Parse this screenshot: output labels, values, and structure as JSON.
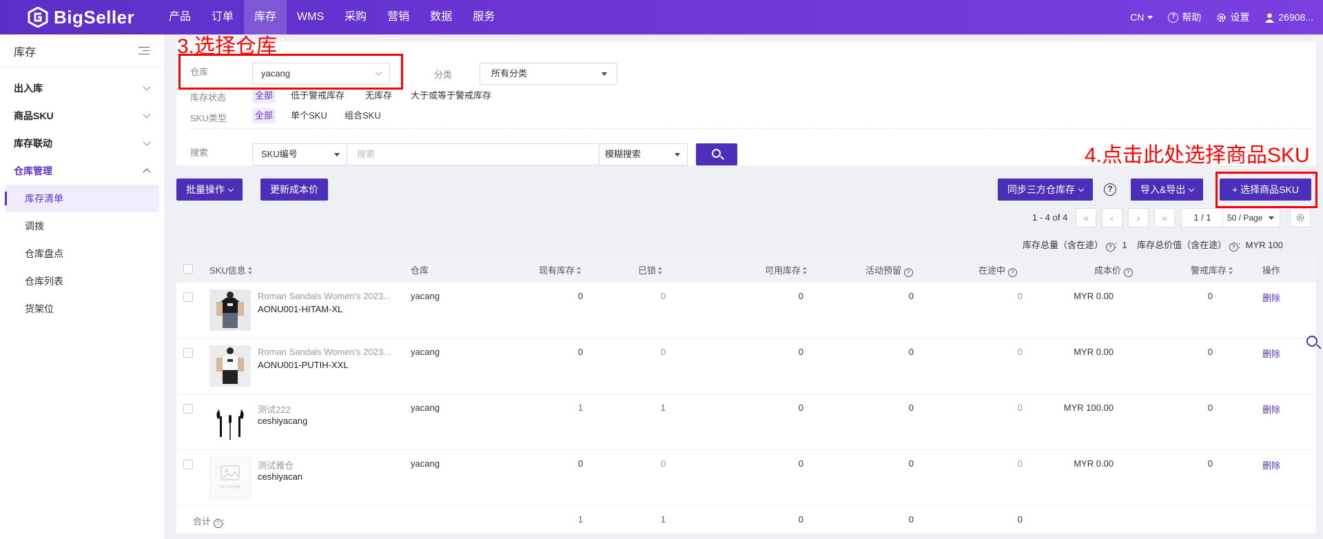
{
  "brand": {
    "name": "BigSeller"
  },
  "nav": {
    "items": [
      "产品",
      "订单",
      "库存",
      "WMS",
      "采购",
      "营销",
      "数据",
      "服务"
    ],
    "active": "库存"
  },
  "topbar": {
    "lang": "CN",
    "help": "帮助",
    "settings": "设置",
    "user": "26908..."
  },
  "sidebar": {
    "title": "库存",
    "groups": [
      "出入库",
      "商品SKU",
      "库存联动",
      "仓库管理"
    ],
    "sub_items": [
      "库存清单",
      "调拨",
      "仓库盘点",
      "仓库列表",
      "货架位"
    ]
  },
  "filters": {
    "warehouse_label": "仓库",
    "warehouse_value": "yacang",
    "category_label": "分类",
    "category_value": "所有分类",
    "stock_status_label": "库存状态",
    "stock_status_options": [
      "全部",
      "低于警戒库存",
      "无库存",
      "大于或等于警戒库存"
    ],
    "sku_type_label": "SKU类型",
    "sku_type_options": [
      "全部",
      "单个SKU",
      "组合SKU"
    ],
    "search_label": "搜索",
    "search_field": "SKU编号",
    "search_placeholder": "搜索",
    "search_mode": "模糊搜索"
  },
  "annotations": {
    "step3": "3.选择仓库",
    "step4": "4.点击此处选择商品SKU"
  },
  "toolbar": {
    "bulk": "批量操作",
    "update_cost": "更新成本价",
    "sync": "同步三方仓库存",
    "import_export": "导入&导出",
    "select_sku": "+ 选择商品SKU"
  },
  "pagination": {
    "range": "1 - 4 of 4",
    "page": "1 / 1",
    "page_size": "50 / Page"
  },
  "totals": {
    "qty_label": "库存总量（含在途）",
    "qty": "1",
    "value_label": "库存总价值（含在途）",
    "value": "MYR 100"
  },
  "table": {
    "columns": [
      "SKU信息",
      "仓库",
      "现有库存",
      "已锁",
      "可用库存",
      "活动预留",
      "在途中",
      "成本价",
      "警戒库存",
      "操作"
    ],
    "rows": [
      {
        "name": "Roman Sandals Women's 2023...",
        "sku": "AONU001-HITAM-XL",
        "warehouse": "yacang",
        "onhand": "0",
        "locked": "0",
        "available": "0",
        "reserved": "0",
        "transit": "0",
        "cost": "MYR 0.00",
        "alert": "0",
        "action": "删除",
        "thumb": "black-shirt"
      },
      {
        "name": "Roman Sandals Women's 2023...",
        "sku": "AONU001-PUTIH-XXL",
        "warehouse": "yacang",
        "onhand": "0",
        "locked": "0",
        "available": "0",
        "reserved": "0",
        "transit": "0",
        "cost": "MYR 0.00",
        "alert": "0",
        "action": "删除",
        "thumb": "white-shirt"
      },
      {
        "name": "测试222",
        "sku": "ceshiyacang",
        "warehouse": "yacang",
        "onhand": "1",
        "locked": "1",
        "available": "0",
        "reserved": "0",
        "transit": "0",
        "cost": "MYR 100.00",
        "alert": "0",
        "action": "删除",
        "thumb": "earphones"
      },
      {
        "name": "测试雅仓",
        "sku": "ceshiyacan",
        "warehouse": "yacang",
        "onhand": "0",
        "locked": "0",
        "available": "0",
        "reserved": "0",
        "transit": "0",
        "cost": "MYR 0.00",
        "alert": "0",
        "action": "删除",
        "thumb": "no-image"
      }
    ],
    "footer": {
      "label": "合计",
      "onhand": "1",
      "locked": "1",
      "available": "0",
      "reserved": "0",
      "transit": "0"
    },
    "no_image_text": "No Image"
  },
  "colors": {
    "primary": "#4b2fb8",
    "nav_gradient": "#6a35d4",
    "annotation": "#ff0000"
  }
}
